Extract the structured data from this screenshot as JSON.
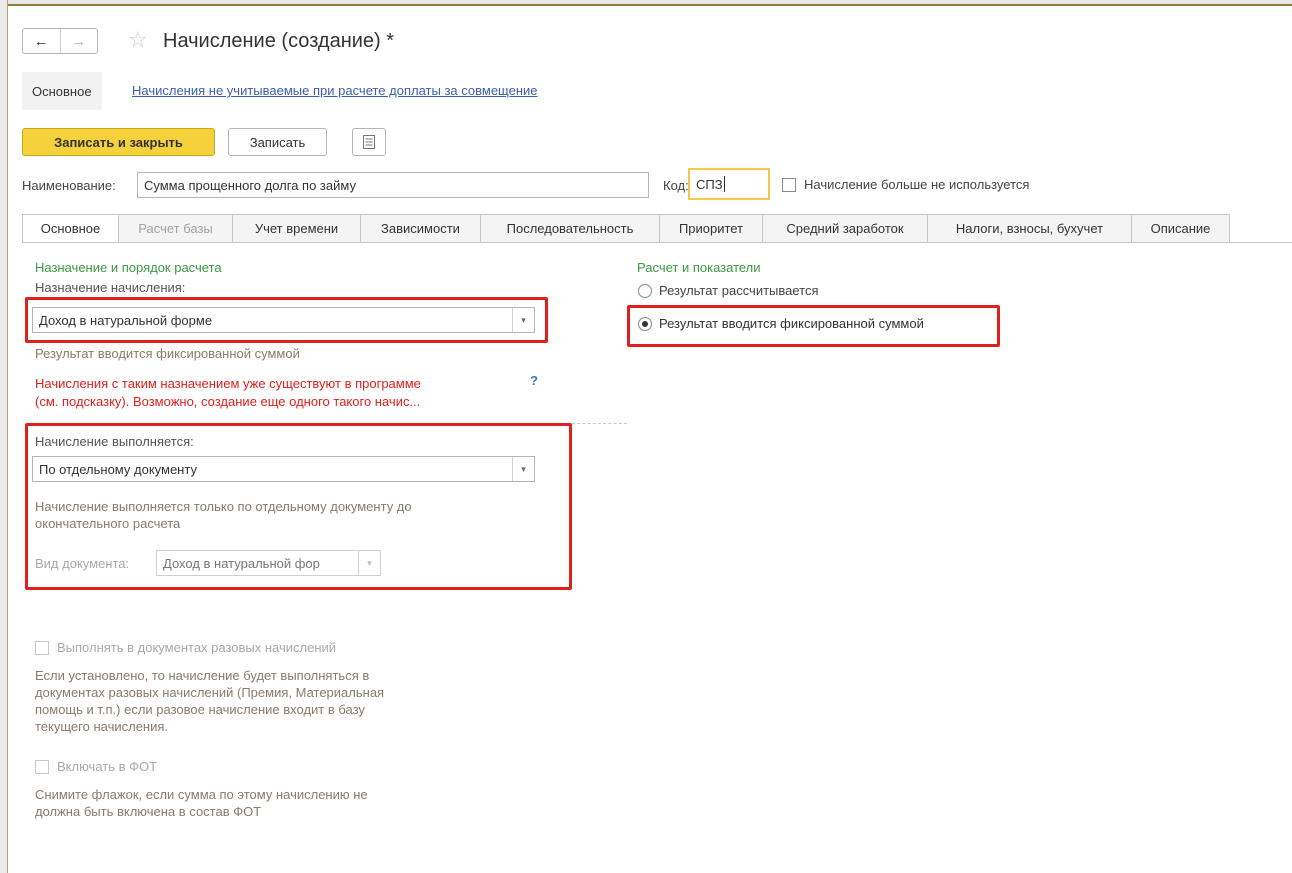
{
  "window": {
    "title": "Начисление (создание) *"
  },
  "top_tabs": {
    "main_label": "Основное",
    "link_label": "Начисления не учитываемые при расчете доплаты за совмещение"
  },
  "toolbar": {
    "save_close_label": "Записать и закрыть",
    "save_label": "Записать"
  },
  "fields": {
    "name_label": "Наименование:",
    "name_value": "Сумма прощенного долга по займу",
    "code_label": "Код:",
    "code_value": "СПЗ",
    "unused_checkbox_label": "Начисление больше не используется",
    "unused_checked": false
  },
  "tabs": [
    {
      "label": "Основное",
      "active": true
    },
    {
      "label": "Расчет базы",
      "disabled": true
    },
    {
      "label": "Учет времени"
    },
    {
      "label": "Зависимости"
    },
    {
      "label": "Последовательность"
    },
    {
      "label": "Приоритет"
    },
    {
      "label": "Средний заработок"
    },
    {
      "label": "Налоги, взносы, бухучет"
    },
    {
      "label": "Описание"
    }
  ],
  "left": {
    "section_title": "Назначение и порядок расчета",
    "purpose_label": "Назначение начисления:",
    "purpose_value": "Доход в натуральной форме",
    "purpose_hint": "Результат вводится фиксированной суммой",
    "warning_line1": "Начисления с таким назначением уже существуют в программе",
    "warning_line2": "(см. подсказку). Возможно, создание еще одного такого начис...",
    "help_mark": "?",
    "performed_label": "Начисление выполняется:",
    "performed_value": "По отдельному документу",
    "performed_hint_line1": "Начисление выполняется только по отдельному документу до",
    "performed_hint_line2": "окончательного расчета",
    "doc_type_label": "Вид документа:",
    "doc_type_value": "Доход в натуральной фор",
    "one_time_label": "Выполнять в документах разовых начислений",
    "one_time_hint": [
      "Если установлено, то начисление будет выполняться в",
      "документах разовых начислений (Премия, Материальная",
      "помощь и т.п.) если разовое начисление входит в базу",
      "текущего начисления."
    ],
    "fot_label": "Включать в ФОТ",
    "fot_hint": [
      "Снимите флажок, если сумма по этому начислению не",
      "должна быть включена в состав ФОТ"
    ]
  },
  "right": {
    "section_title": "Расчет и показатели",
    "option_calc": "Результат рассчитывается",
    "option_fixed": "Результат вводится фиксированной суммой",
    "selected": "fixed"
  },
  "colors": {
    "highlight_red": "#e0201c",
    "section_green": "#3a9a43",
    "primary_yellow": "#f5d23b",
    "link_blue": "#3b5fa8"
  }
}
